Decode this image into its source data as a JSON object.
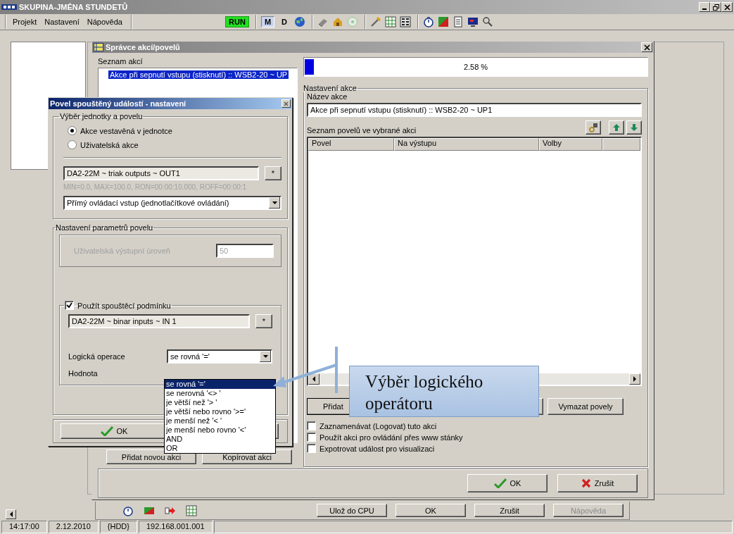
{
  "window": {
    "title": "SKUPINA-JMÉNA STUNDETŮ"
  },
  "menu": [
    "Projekt",
    "Nastavení",
    "Nápověda"
  ],
  "toolbar": {
    "run": "RUN",
    "modes": [
      {
        "label": "M",
        "selected": true
      },
      {
        "label": "D",
        "selected": false
      }
    ]
  },
  "manager": {
    "title": "Správce akcí/povelů",
    "actions_label": "Seznam akcí",
    "actions": [
      {
        "label": "Akce při sepnutí vstupu (stisknutí) :: WSB2-20 ~ UP",
        "selected": true
      }
    ],
    "progress": {
      "level": 0.0258,
      "reading": "2.58 %"
    },
    "settings_label": "Nastavení akce",
    "name_label": "Název akce",
    "name_value": "Akce při sepnutí vstupu (stisknutí) :: WSB2-20 ~ UP1",
    "commands_label": "Seznam povelů ve vybrané akci",
    "columns": [
      "Povel",
      "Na výstupu",
      "Volby"
    ],
    "add_command": "Přidat",
    "delete_commands": "Vymazat povely",
    "options": [
      {
        "label": "Zaznamenávat (Logovat) tuto akci",
        "checked": false
      },
      {
        "label": "Použít akci pro ovládání přes www stánky",
        "checked": false
      },
      {
        "label": "Expotrovat událost pro visualizaci",
        "checked": false
      }
    ],
    "left_buttons": [
      "Přidat novou akci",
      "Kopírovat akci"
    ],
    "ok": "OK",
    "cancel": "Zrušit"
  },
  "dialog": {
    "title": "Povel spouštěný událostí - nastavení",
    "group1": "Výběr jednotky a povelu",
    "radios": [
      {
        "label": "Akce vestavěná v jednotce",
        "selected": true
      },
      {
        "label": "Uživatelská akce",
        "selected": false
      }
    ],
    "unit_value": "DA2-22M ~ triak outputs ~ OUT1",
    "pick": "*",
    "limits": "MIN=0.0, MAX=100.0, RON=00:00:10.000, ROFF=00:00:1",
    "mode_value": "Přímý ovládací vstup (jednotlačítkové ovládání)",
    "group2": "Nastavení parametrů povelu",
    "level_label": "Uživatelská výstupní úroveň",
    "level_value": "50",
    "level_disabled": true,
    "condition": {
      "label": "Použít spouštěcí podmínku",
      "checked": true
    },
    "condition_value": "DA2-22M ~ binar inputs ~ IN 1",
    "pick2": "*",
    "logic_label": "Logická operace",
    "logic_value": "se rovná '='",
    "value_label": "Hodnota",
    "ok": "OK"
  },
  "dropdown": [
    {
      "label": "se rovná '='",
      "selected": true
    },
    {
      "label": "se nerovná  '<> '",
      "selected": false
    },
    {
      "label": "je větší než '> '",
      "selected": false
    },
    {
      "label": "je větší nebo rovno '>='",
      "selected": false
    },
    {
      "label": "je menší než '< '",
      "selected": false
    },
    {
      "label": "je menší nebo rovno '<'",
      "selected": false
    },
    {
      "label": "AND",
      "selected": false
    },
    {
      "label": "OR",
      "selected": false
    }
  ],
  "callout": {
    "text": "Výběr logického operátoru"
  },
  "main_buttons": [
    {
      "label": "Ulož do CPU",
      "disabled": false
    },
    {
      "label": "OK",
      "disabled": false
    },
    {
      "label": "Zrušit",
      "disabled": false
    },
    {
      "label": "Nápověda",
      "disabled": true
    }
  ],
  "status_bar": [
    "14:17:00",
    "2.12.2010",
    "{HDD}",
    "192.168.001.001"
  ]
}
